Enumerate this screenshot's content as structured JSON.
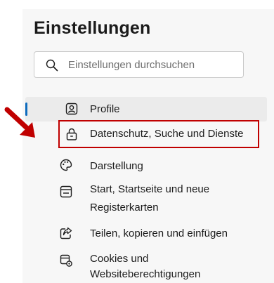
{
  "settings": {
    "title": "Einstellungen",
    "search": {
      "placeholder": "Einstellungen durchsuchen",
      "value": ""
    },
    "nav": [
      {
        "label": "Profile",
        "icon": "profile-icon",
        "active": true
      },
      {
        "label": "Datenschutz, Suche und Dienste",
        "icon": "lock-icon",
        "highlighted": true
      },
      {
        "label": "Darstellung",
        "icon": "palette-icon"
      },
      {
        "label_line1": "Start, Startseite und neue",
        "label_line2": "Registerkarten",
        "icon": "newtab-icon"
      },
      {
        "label": "Teilen, kopieren und einfügen",
        "icon": "share-icon"
      },
      {
        "label_line1": "Cookies und",
        "label_line2": "Websiteberechtigungen",
        "icon": "cookies-permissions-icon"
      }
    ]
  },
  "annotation": {
    "arrow_color": "#c00000",
    "box_color": "#c00000"
  },
  "colors": {
    "accent": "#0f6cbd",
    "panel_bg": "#f7f7f7",
    "text": "#1b1b1b"
  }
}
